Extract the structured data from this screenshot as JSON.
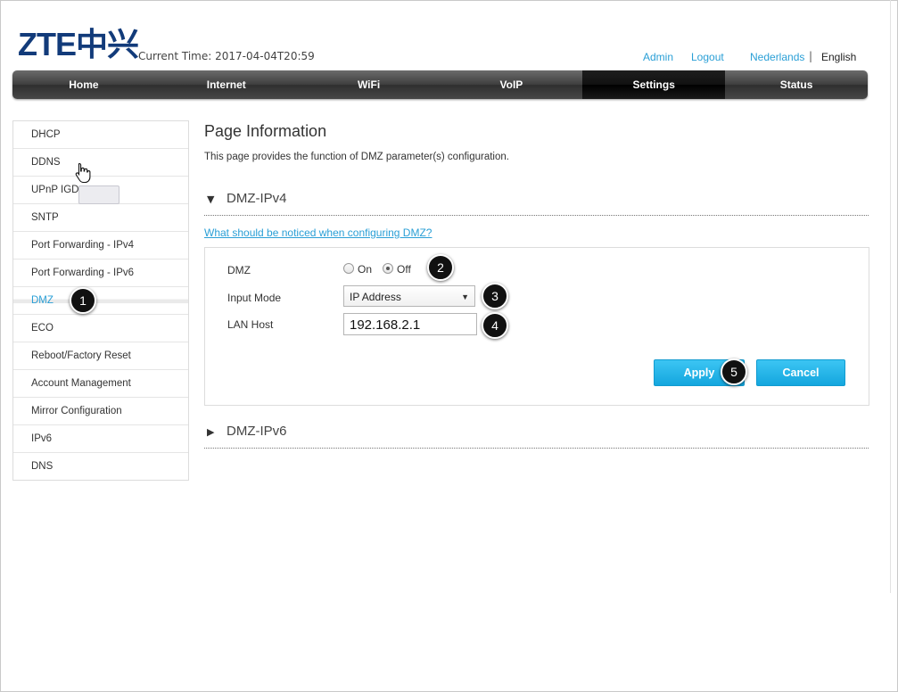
{
  "header": {
    "logo": "ZTE中兴",
    "current_time": "Current Time: 2017-04-04T20:59",
    "admin_link": "Admin",
    "logout_link": "Logout",
    "lang_nl": "Nederlands",
    "lang_sep": "|",
    "lang_en": "English"
  },
  "nav": {
    "items": [
      "Home",
      "Internet",
      "WiFi",
      "VoIP",
      "Settings",
      "Status"
    ],
    "active": "Settings"
  },
  "sidebar": {
    "items": [
      "DHCP",
      "DDNS",
      "UPnP IGD",
      "SNTP",
      "Port Forwarding - IPv4",
      "Port Forwarding - IPv6",
      "DMZ",
      "ECO",
      "Reboot/Factory Reset",
      "Account Management",
      "Mirror Configuration",
      "IPv6",
      "DNS"
    ],
    "active": "DMZ"
  },
  "main": {
    "title": "Page Information",
    "description": "This page provides the function of DMZ parameter(s) configuration.",
    "section_ipv4": "DMZ-IPv4",
    "section_ipv6": "DMZ-IPv6",
    "help_link": "What should be noticed when configuring DMZ?",
    "form": {
      "dmz_label": "DMZ",
      "on_label": "On",
      "off_label": "Off",
      "dmz_value": "Off",
      "input_mode_label": "Input Mode",
      "input_mode_value": "IP Address",
      "lan_host_label": "LAN Host",
      "lan_host_value": "192.168.2.1",
      "apply_label": "Apply",
      "cancel_label": "Cancel"
    }
  },
  "steps": [
    "1",
    "2",
    "3",
    "4",
    "5"
  ],
  "colors": {
    "accent": "#2a9fd6",
    "button": "#14a6de",
    "logo": "#123b7a",
    "navbar": "#3e3e3e"
  }
}
